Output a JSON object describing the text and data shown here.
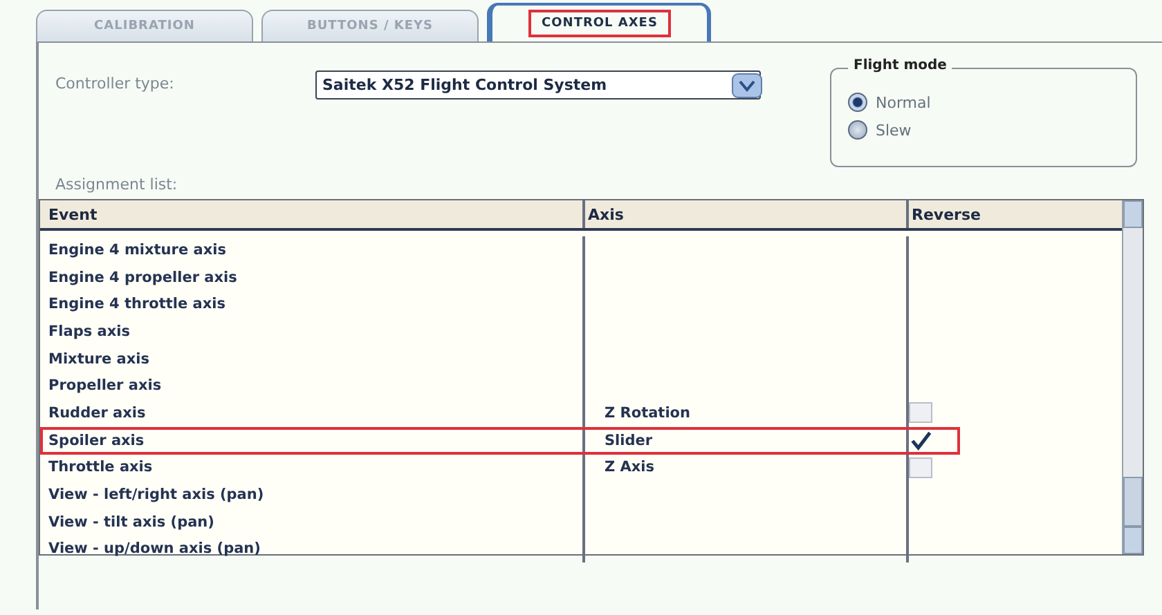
{
  "tabs": [
    {
      "label": "CALIBRATION",
      "selected": false,
      "highlighted": false
    },
    {
      "label": "BUTTONS / KEYS",
      "selected": false,
      "highlighted": false
    },
    {
      "label": "CONTROL AXES",
      "selected": true,
      "highlighted": true
    }
  ],
  "controller_type": {
    "label": "Controller type:",
    "value": "Saitek X52 Flight Control System"
  },
  "flight_mode": {
    "title": "Flight mode",
    "options": [
      {
        "label": "Normal",
        "selected": true
      },
      {
        "label": "Slew",
        "selected": false
      }
    ]
  },
  "assignment_list": {
    "label": "Assignment list:",
    "columns": [
      "Event",
      "Axis",
      "Reverse"
    ],
    "rows": [
      {
        "kind": "plain",
        "event": "Engine 4 mixture axis",
        "highlighted": false
      },
      {
        "kind": "plain",
        "event": "Engine 4 propeller axis",
        "highlighted": false
      },
      {
        "kind": "plain",
        "event": "Engine 4 throttle axis",
        "highlighted": false
      },
      {
        "kind": "plain",
        "event": "Flaps axis",
        "highlighted": false
      },
      {
        "kind": "plain",
        "event": "Mixture axis",
        "highlighted": false
      },
      {
        "kind": "plain",
        "event": "Propeller axis",
        "highlighted": false
      },
      {
        "kind": "assigned",
        "event": "Rudder axis",
        "axis": "Z Rotation",
        "reverse": false,
        "highlighted": false
      },
      {
        "kind": "assigned",
        "event": "Spoiler axis",
        "axis": "Slider",
        "reverse": true,
        "highlighted": true
      },
      {
        "kind": "assigned",
        "event": "Throttle axis",
        "axis": "Z Axis",
        "reverse": false,
        "highlighted": false
      },
      {
        "kind": "plain",
        "event": "View - left/right axis (pan)",
        "highlighted": false
      },
      {
        "kind": "plain",
        "event": "View - tilt axis (pan)",
        "highlighted": false
      },
      {
        "kind": "plain",
        "event": "View - up/down axis (pan)",
        "highlighted": false
      }
    ]
  }
}
